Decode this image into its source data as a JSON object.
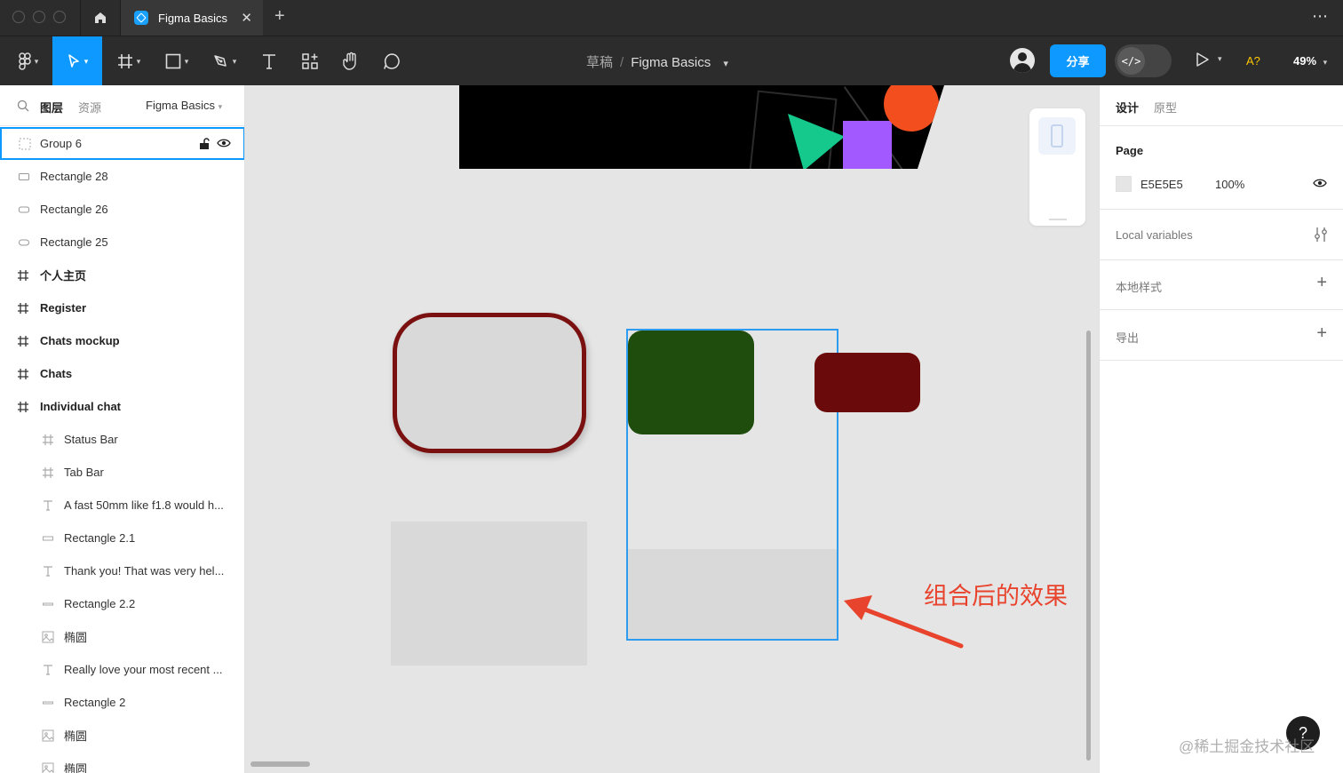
{
  "titlebar": {
    "tab_title": "Figma Basics",
    "close": "✕",
    "new_tab": "+",
    "more": "⋯"
  },
  "toolbar": {
    "draft": "草稿",
    "separator": "/",
    "file_name": "Figma Basics",
    "share": "分享",
    "dev_mode": "</>",
    "ai_indicator": "A?",
    "zoom": "49%",
    "accent": "#0d99ff"
  },
  "left_panel": {
    "tab_layers": "图层",
    "tab_assets": "资源",
    "page_name": "Figma Basics",
    "layers": [
      {
        "name": "Group 6",
        "icon": "group-icon"
      },
      {
        "name": "Rectangle 28",
        "icon": "rectangle-icon"
      },
      {
        "name": "Rectangle 26",
        "icon": "rectangle-icon"
      },
      {
        "name": "Rectangle 25",
        "icon": "rectangle-icon"
      },
      {
        "name": "个人主页",
        "icon": "frame-icon"
      },
      {
        "name": "Register",
        "icon": "frame-icon"
      },
      {
        "name": "Chats mockup",
        "icon": "frame-icon"
      },
      {
        "name": "Chats",
        "icon": "frame-icon"
      },
      {
        "name": "Individual chat",
        "icon": "frame-icon"
      },
      {
        "name": "Status Bar",
        "icon": "frame-icon"
      },
      {
        "name": "Tab Bar",
        "icon": "frame-icon"
      },
      {
        "name": "A fast 50mm like f1.8 would h...",
        "icon": "text-icon"
      },
      {
        "name": "Rectangle 2.1",
        "icon": "rectangle-icon"
      },
      {
        "name": "Thank you! That was very hel...",
        "icon": "text-icon"
      },
      {
        "name": "Rectangle 2.2",
        "icon": "rectangle-icon"
      },
      {
        "name": "椭圆",
        "icon": "image-icon"
      },
      {
        "name": "Really love your most recent ...",
        "icon": "text-icon"
      },
      {
        "name": "Rectangle 2",
        "icon": "rectangle-icon"
      },
      {
        "name": "椭圆",
        "icon": "image-icon"
      },
      {
        "name": "椭圆",
        "icon": "image-icon"
      }
    ]
  },
  "canvas": {
    "annotation": "组合后的效果",
    "annotation_color": "#e8432c",
    "background": "#e5e5e5"
  },
  "right_panel": {
    "tab_design": "设计",
    "tab_prototype": "原型",
    "page_label": "Page",
    "page_color": "E5E5E5",
    "page_opacity": "100%",
    "local_variables": "Local variables",
    "local_styles": "本地样式",
    "export": "导出"
  },
  "help": "?",
  "watermark": "@稀土掘金技术社区"
}
